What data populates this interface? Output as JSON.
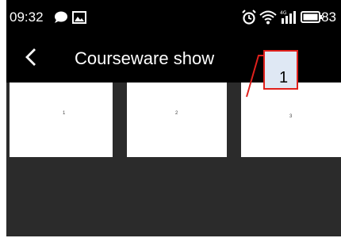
{
  "status_bar": {
    "time": "09:32",
    "battery": "83",
    "icons": [
      "chat-bubble-icon",
      "image-icon",
      "alarm-icon",
      "wifi-icon",
      "signal-icon",
      "battery-icon"
    ]
  },
  "app_bar": {
    "back_icon": "chevron-left-icon",
    "title": "Courseware show"
  },
  "thumbnails": [
    {
      "label": "1"
    },
    {
      "label": "2"
    },
    {
      "label": "3"
    }
  ],
  "annotation": {
    "label": "1"
  },
  "colors": {
    "status_bar_bg": "#000000",
    "app_bar_bg": "#000000",
    "content_bg": "#2b2b2b",
    "thumbnail_bg": "#ffffff",
    "annotation_border": "#e0201c",
    "annotation_fill": "#dfe8f4"
  }
}
